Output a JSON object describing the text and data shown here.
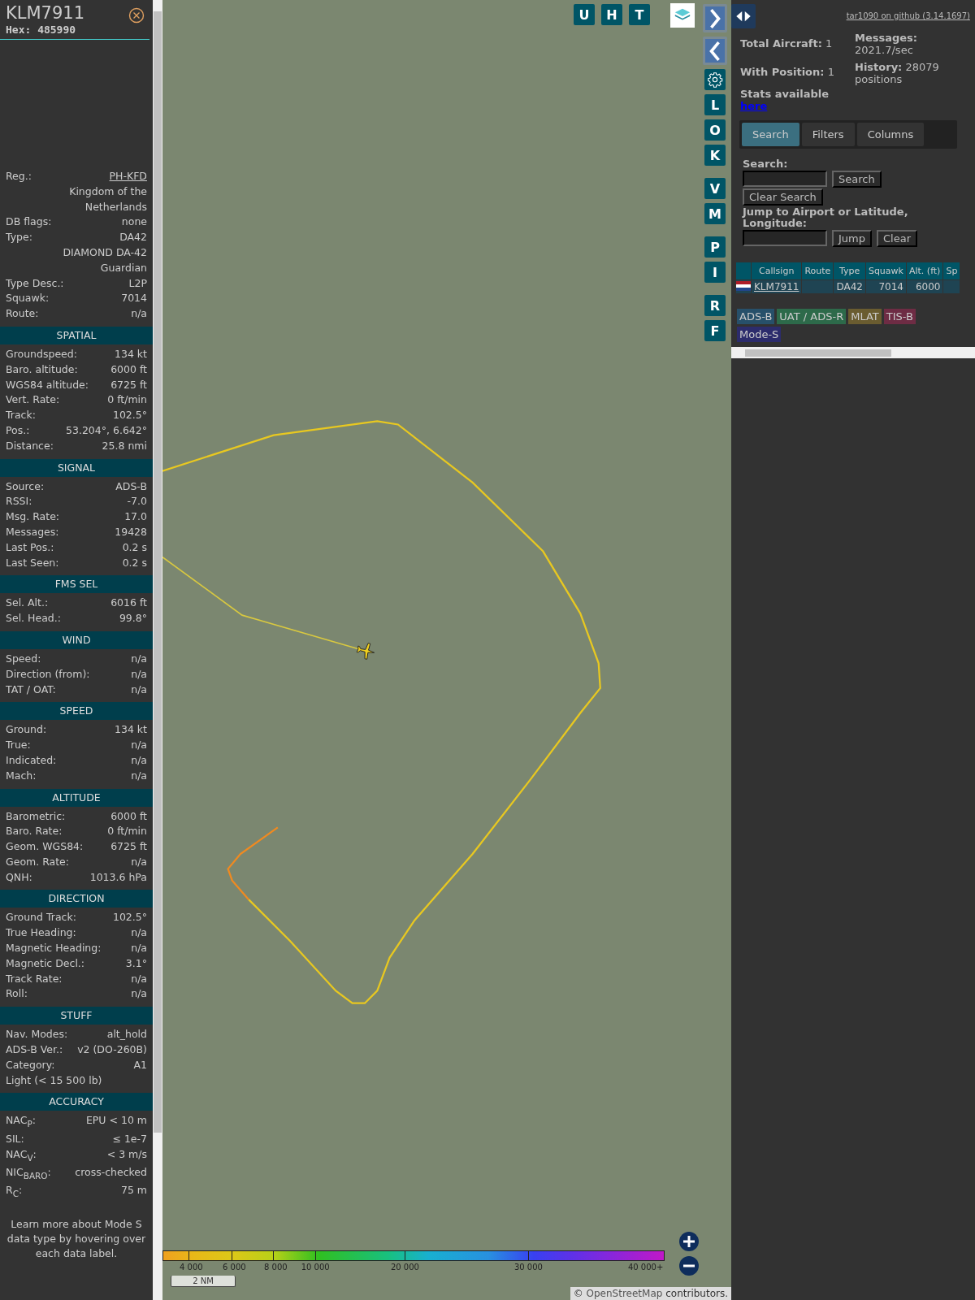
{
  "aircraft_panel": {
    "callsign": "KLM7911",
    "hex": "Hex: 485990",
    "details": [
      {
        "kind": "link",
        "label": "Reg.:",
        "value": "PH-KFD"
      },
      {
        "kind": "note",
        "value": "Kingdom of the Netherlands"
      },
      {
        "kind": "pair",
        "label": "DB flags:",
        "value": "none"
      },
      {
        "kind": "pair",
        "label": "Type:",
        "value": "DA42"
      },
      {
        "kind": "note",
        "value": "DIAMOND DA-42 Guardian"
      },
      {
        "kind": "pair",
        "label": "Type Desc.:",
        "value": "L2P"
      },
      {
        "kind": "pair",
        "label": "Squawk:",
        "value": "7014"
      },
      {
        "kind": "pair",
        "label": "Route:",
        "value": "n/a"
      }
    ],
    "sections": [
      {
        "title": "SPATIAL",
        "rows": [
          {
            "kind": "pair",
            "label": "Groundspeed:",
            "value": "134 kt"
          },
          {
            "kind": "pair",
            "label": "Baro. altitude:",
            "value": "6000 ft"
          },
          {
            "kind": "pair",
            "label": "WGS84 altitude:",
            "value": "6725 ft"
          },
          {
            "kind": "pair",
            "label": "Vert. Rate:",
            "value": "0 ft/min"
          },
          {
            "kind": "pair",
            "label": "Track:",
            "value": "102.5°"
          },
          {
            "kind": "pair",
            "label": "Pos.:",
            "value": "53.204°, 6.642°"
          },
          {
            "kind": "pair",
            "label": "Distance:",
            "value": "25.8 nmi"
          }
        ]
      },
      {
        "title": "SIGNAL",
        "rows": [
          {
            "kind": "pair",
            "label": "Source:",
            "value": "ADS-B"
          },
          {
            "kind": "pair",
            "label": "RSSI:",
            "value": "-7.0"
          },
          {
            "kind": "pair",
            "label": "Msg. Rate:",
            "value": "17.0"
          },
          {
            "kind": "pair",
            "label": "Messages:",
            "value": "19428"
          },
          {
            "kind": "pair",
            "label": "Last Pos.:",
            "value": "0.2 s"
          },
          {
            "kind": "pair",
            "label": "Last Seen:",
            "value": "0.2 s"
          }
        ]
      },
      {
        "title": "FMS SEL",
        "rows": [
          {
            "kind": "pair",
            "label": "Sel. Alt.:",
            "value": "6016 ft"
          },
          {
            "kind": "pair",
            "label": "Sel. Head.:",
            "value": "99.8°"
          }
        ]
      },
      {
        "title": "WIND",
        "rows": [
          {
            "kind": "pair",
            "label": "Speed:",
            "value": "n/a"
          },
          {
            "kind": "pair",
            "label": "Direction (from):",
            "value": "n/a"
          },
          {
            "kind": "pair",
            "label": "TAT / OAT:",
            "value": "n/a"
          }
        ]
      },
      {
        "title": "SPEED",
        "rows": [
          {
            "kind": "pair",
            "label": "Ground:",
            "value": "134 kt"
          },
          {
            "kind": "pair",
            "label": "True:",
            "value": "n/a"
          },
          {
            "kind": "pair",
            "label": "Indicated:",
            "value": "n/a"
          },
          {
            "kind": "pair",
            "label": "Mach:",
            "value": "n/a"
          }
        ]
      },
      {
        "title": "ALTITUDE",
        "rows": [
          {
            "kind": "pair",
            "label": "Barometric:",
            "value": "6000 ft"
          },
          {
            "kind": "pair",
            "label": "Baro. Rate:",
            "value": "0 ft/min"
          },
          {
            "kind": "pair",
            "label": "Geom. WGS84:",
            "value": "6725 ft"
          },
          {
            "kind": "pair",
            "label": "Geom. Rate:",
            "value": "n/a"
          },
          {
            "kind": "pair",
            "label": "QNH:",
            "value": "1013.6 hPa"
          }
        ]
      },
      {
        "title": "DIRECTION",
        "rows": [
          {
            "kind": "pair",
            "label": "Ground Track:",
            "value": "102.5°"
          },
          {
            "kind": "pair",
            "label": "True Heading:",
            "value": "n/a"
          },
          {
            "kind": "pair",
            "label": "Magnetic Heading:",
            "value": "n/a"
          },
          {
            "kind": "pair",
            "label": "Magnetic Decl.:",
            "value": "3.1°"
          },
          {
            "kind": "pair",
            "label": "Track Rate:",
            "value": "n/a"
          },
          {
            "kind": "pair",
            "label": "Roll:",
            "value": "n/a"
          }
        ]
      },
      {
        "title": "STUFF",
        "rows": [
          {
            "kind": "pair",
            "label": "Nav. Modes:",
            "value": "alt_hold"
          },
          {
            "kind": "pair",
            "label": "ADS-B Ver.:",
            "value": "v2 (DO-260B)"
          },
          {
            "kind": "pair",
            "label": "Category:",
            "value": "A1"
          },
          {
            "kind": "wide",
            "value": "Light (< 15 500 lb)"
          }
        ]
      },
      {
        "title": "ACCURACY",
        "rows": [
          {
            "kind": "pair",
            "label": "NAC$_{P}$:",
            "value": "EPU < 10 m"
          },
          {
            "kind": "pair",
            "label": "SIL:",
            "value": "≤ 1e-7"
          },
          {
            "kind": "pair",
            "label": "NAC$_{V}$:",
            "value": "< 3 m/s"
          },
          {
            "kind": "pair",
            "label": "NIC$_{BARO}$:",
            "value": "cross-checked"
          },
          {
            "kind": "pair",
            "label": "R$_{C}$:",
            "value": "75 m"
          }
        ]
      }
    ],
    "footer": "Learn more about Mode S data type by hovering over each data label."
  },
  "map": {
    "top_buttons": [
      "U",
      "H",
      "T"
    ],
    "side_buttons": [
      {
        "kind": "next"
      },
      {
        "kind": "prev"
      },
      {
        "kind": "settings"
      }
    ],
    "letter_groups": [
      [
        "L",
        "O",
        "K"
      ],
      [
        "V",
        "M"
      ],
      [
        "P",
        "I"
      ],
      [
        "R",
        "F"
      ]
    ],
    "altitude_legend": [
      "4 000",
      "6 000",
      "8 000",
      "10 000",
      "20 000",
      "30 000",
      "40 000+"
    ],
    "scale_bar": "2 NM",
    "attribution": {
      "prefix": "©",
      "link": "OpenStreetMap",
      "suffix": "contributors."
    }
  },
  "side_panel": {
    "github_link": "tar1090 on github (3.14.1697)",
    "stats_left": [
      "**Total Aircraft:** 1",
      "**With Position:** 1"
    ],
    "stats_available": "Stats available",
    "stats_link": "here",
    "stats_right": [
      "**Messages:** 2021.7/sec",
      "**History:** 28079 positions"
    ],
    "tabs": [
      {
        "label": "Search",
        "selected": true
      },
      {
        "label": "Filters",
        "selected": false
      },
      {
        "label": "Columns",
        "selected": false
      }
    ],
    "search": {
      "label": "Search:",
      "button": "Search",
      "clear_button": "Clear Search",
      "jump_label": "Jump to Airport or Latitude, Longitude:",
      "jump_button": "Jump",
      "jump_clear_button": "Clear"
    },
    "table": {
      "columns": [
        "Callsign",
        "Route",
        "Type",
        "Squawk",
        "Alt. (ft)",
        "Sp"
      ],
      "rows": [
        {
          "callsign": "KLM7911",
          "type": "DA42",
          "squawk": "7014",
          "altitude": "6000"
        }
      ]
    },
    "source_tags": [
      {
        "label": "ADS-B",
        "color": "#27506a"
      },
      {
        "label": "UAT / ADS-R",
        "color": "#2d6a4a"
      },
      {
        "label": "MLAT",
        "color": "#6a5c30"
      },
      {
        "label": "TIS-B",
        "color": "#6e2c44"
      },
      {
        "label": "Mode-S",
        "color": "#2c2c6c"
      }
    ]
  }
}
